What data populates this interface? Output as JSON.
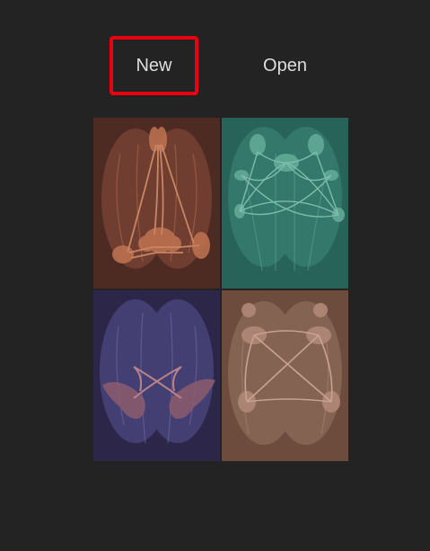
{
  "toolbar": {
    "new_label": "New",
    "open_label": "Open"
  },
  "colors": {
    "background": "#232323",
    "highlight": "#e8000f",
    "label": "#dedede",
    "tile_top_left": "#4e2b22",
    "tile_top_right": "#276358",
    "tile_bottom_left": "#2c2749",
    "tile_bottom_right": "#6d4b3d"
  },
  "tiles": [
    {
      "icon": "brain-tract-orange-icon"
    },
    {
      "icon": "brain-tract-teal-icon"
    },
    {
      "icon": "brain-tract-blue-icon"
    },
    {
      "icon": "brain-tract-tan-icon"
    }
  ]
}
